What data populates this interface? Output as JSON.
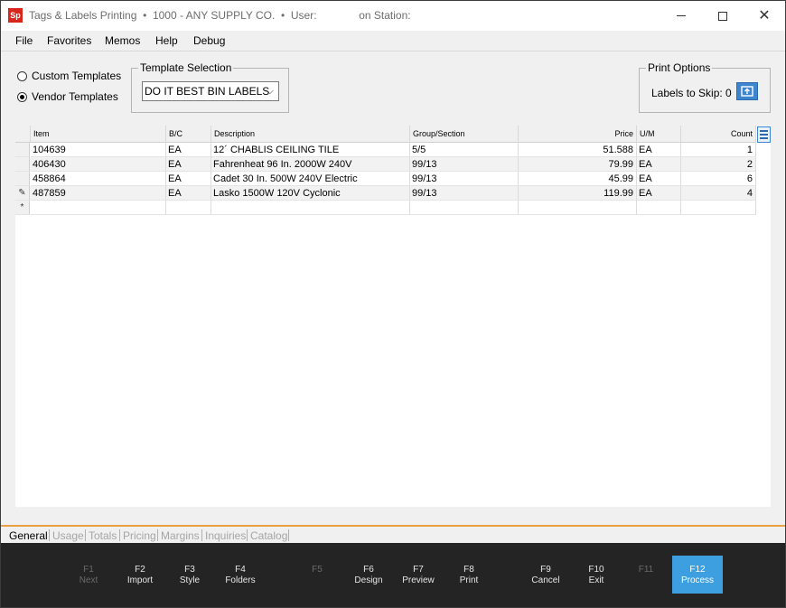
{
  "window": {
    "logo": "Sp",
    "title": "Tags & Labels Printing  •  1000 - ANY SUPPLY CO.  •  User:              on Station:"
  },
  "menu": [
    "File",
    "Favorites",
    "Memos",
    "Help",
    "Debug"
  ],
  "template_options": {
    "custom_label": "Custom Templates",
    "vendor_label": "Vendor Templates",
    "selected": "Vendor Templates"
  },
  "template_selection": {
    "legend": "Template Selection",
    "value": "DO IT BEST BIN LABELS"
  },
  "print_options": {
    "legend": "Print Options",
    "labels_to_skip_label": "Labels to Skip: 0"
  },
  "grid": {
    "columns": [
      "Item",
      "B/C",
      "Description",
      "Group/Section",
      "Price",
      "U/M",
      "Count"
    ],
    "rows": [
      {
        "item": "104639",
        "bc": "EA",
        "description": "12´ CHABLIS CEILING TILE",
        "group": "5/5",
        "price": "51.588",
        "um": "EA",
        "count": "1",
        "marker": ""
      },
      {
        "item": "406430",
        "bc": "EA",
        "description": "Fahrenheat 96 In. 2000W 240V",
        "group": "99/13",
        "price": "79.99",
        "um": "EA",
        "count": "2",
        "marker": ""
      },
      {
        "item": "458864",
        "bc": "EA",
        "description": "Cadet 30 In. 500W 240V Electric",
        "group": "99/13",
        "price": "45.99",
        "um": "EA",
        "count": "6",
        "marker": ""
      },
      {
        "item": "487859",
        "bc": "EA",
        "description": "Lasko 1500W 120V Cyclonic",
        "group": "99/13",
        "price": "119.99",
        "um": "EA",
        "count": "4",
        "marker": "✎"
      }
    ],
    "new_row_marker": "*"
  },
  "tabs": [
    "General",
    "Usage",
    "Totals",
    "Pricing",
    "Margins",
    "Inquiries",
    "Catalog"
  ],
  "active_tab": "General",
  "function_keys": [
    {
      "key": "F1",
      "label": "Next",
      "enabled": false
    },
    {
      "key": "F2",
      "label": "Import",
      "enabled": true
    },
    {
      "key": "F3",
      "label": "Style",
      "enabled": true
    },
    {
      "key": "F4",
      "label": "Folders",
      "enabled": true
    },
    {
      "key": "F5",
      "label": "",
      "enabled": false
    },
    {
      "key": "F6",
      "label": "Design",
      "enabled": true
    },
    {
      "key": "F7",
      "label": "Preview",
      "enabled": true
    },
    {
      "key": "F8",
      "label": "Print",
      "enabled": true
    },
    {
      "key": "F9",
      "label": "Cancel",
      "enabled": true
    },
    {
      "key": "F10",
      "label": "Exit",
      "enabled": true
    },
    {
      "key": "F11",
      "label": "",
      "enabled": false
    },
    {
      "key": "F12",
      "label": "Process",
      "enabled": true
    }
  ],
  "colors": {
    "accent": "#3d9ee0",
    "tab_accent": "#e8a040",
    "fkey_bar": "#242424",
    "logo": "#d9261c"
  }
}
